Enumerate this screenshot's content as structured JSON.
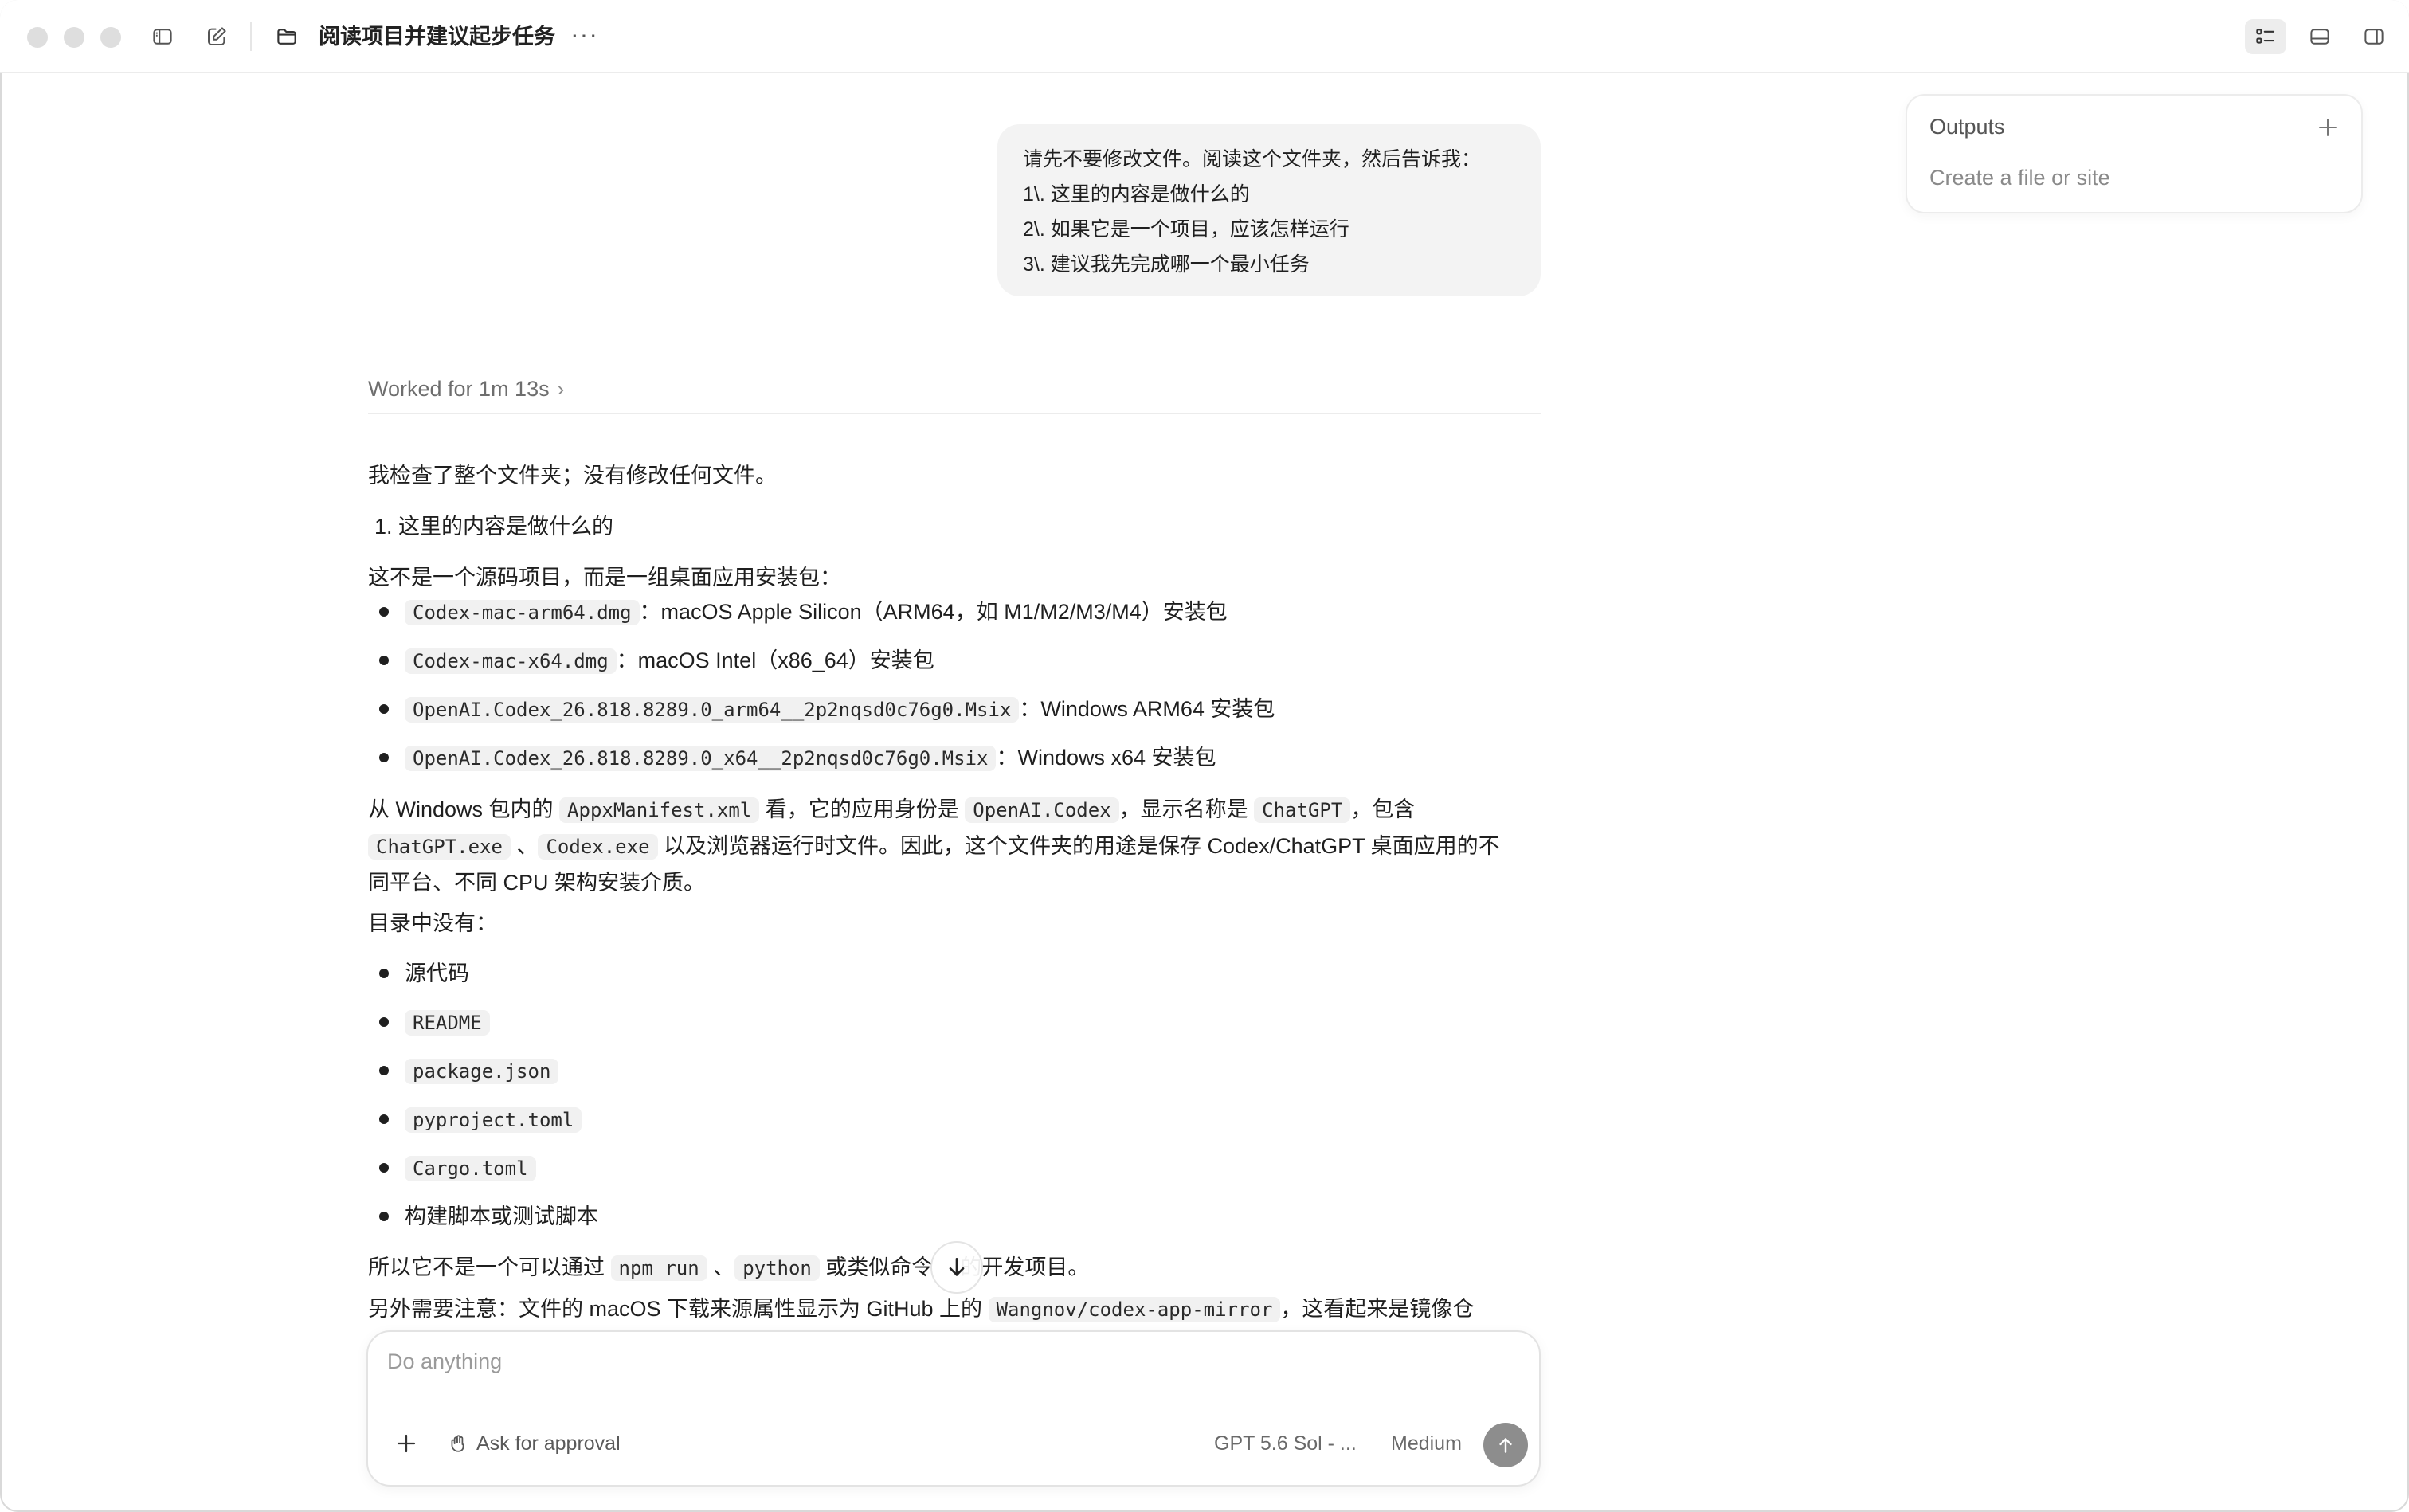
{
  "window": {
    "title": "阅读项目并建议起步任务",
    "more_label": "···"
  },
  "outputs": {
    "title": "Outputs",
    "hint": "Create a file or site"
  },
  "user_message": {
    "lines": [
      "请先不要修改文件。阅读这个文件夹，然后告诉我：",
      "1\\. 这里的内容是做什么的",
      "2\\. 如果它是一个项目，应该怎样运行",
      "3\\. 建议我先完成哪一个最小任务"
    ]
  },
  "worked": {
    "label": "Worked for 1m 13s"
  },
  "response": {
    "intro": "我检查了整个文件夹；没有修改任何文件。",
    "heading1": "1. 这里的内容是做什么的",
    "para1": "这不是一个源码项目，而是一组桌面应用安装包：",
    "packages": [
      {
        "code": "Codex-mac-arm64.dmg",
        "desc": "：macOS Apple Silicon（ARM64，如 M1/M2/M3/M4）安装包"
      },
      {
        "code": "Codex-mac-x64.dmg",
        "desc": "：macOS Intel（x86_64）安装包"
      },
      {
        "code": "OpenAI.Codex_26.818.8289.0_arm64__2p2nqsd0c76g0.Msix",
        "desc": "：Windows ARM64 安装包"
      },
      {
        "code": "OpenAI.Codex_26.818.8289.0_x64__2p2nqsd0c76g0.Msix",
        "desc": "：Windows x64 安装包"
      }
    ],
    "para2": {
      "t1": "从 Windows 包内的 ",
      "c1": "AppxManifest.xml",
      "t2": " 看，它的应用身份是 ",
      "c2": "OpenAI.Codex",
      "t3": "，显示名称是 ",
      "c3": "ChatGPT",
      "t4": "，包含",
      "c4": "ChatGPT.exe",
      "t5": " 、",
      "c5": "Codex.exe",
      "t6": " 以及浏览器运行时文件。因此，这个文件夹的用途是保存 Codex/ChatGPT 桌面应用的不",
      "t7": "同平台、不同 CPU 架构安装介质。"
    },
    "missing_heading": "目录中没有：",
    "missing": [
      {
        "text": "源代码",
        "code": false
      },
      {
        "text": "README",
        "code": true
      },
      {
        "text": "package.json",
        "code": true
      },
      {
        "text": "pyproject.toml",
        "code": true
      },
      {
        "text": "Cargo.toml",
        "code": true
      },
      {
        "text": "构建脚本或测试脚本",
        "code": false
      }
    ],
    "para3": {
      "t1": "所以它不是一个可以通过 ",
      "c1": "npm run",
      "t2": " 、",
      "c2": "python",
      "t3": " 或类似命令",
      "t4": "的开发项目。"
    },
    "para4": {
      "t1": "另外需要注意：文件的 macOS 下载来源属性显示为 GitHub 上的 ",
      "c1": "Wangnov/codex-app-mirror",
      "t2": "，这看起来是镜像仓"
    }
  },
  "composer": {
    "placeholder": "Do anything",
    "approval_label": "Ask for approval",
    "model_label": "GPT 5.6 Sol - ...",
    "effort_label": "Medium"
  }
}
